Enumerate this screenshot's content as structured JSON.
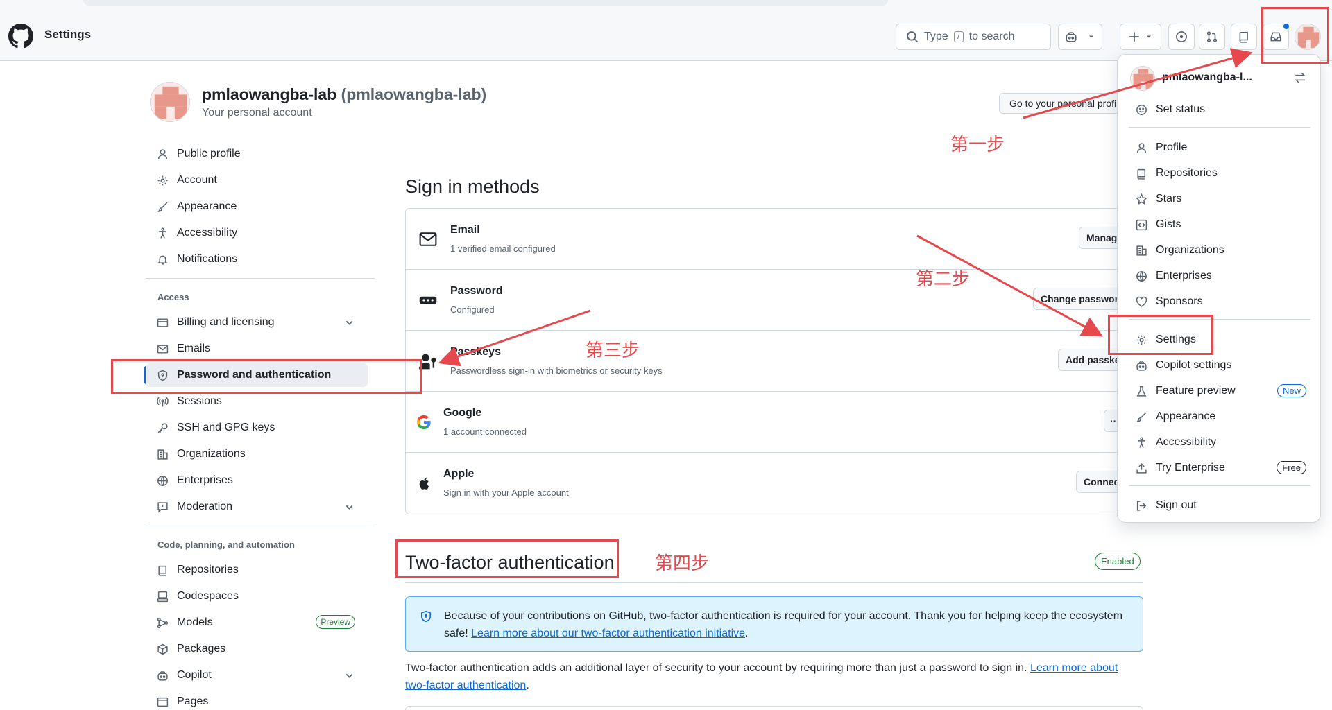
{
  "header": {
    "title": "Settings",
    "search_prefix": "Type",
    "search_key": "/",
    "search_suffix": "to search"
  },
  "profile": {
    "name": "pmlaowangba-lab",
    "alias": "(pmlaowangba-lab)",
    "subtitle": "Your personal account",
    "go_button": "Go to your personal profile"
  },
  "sidebar": {
    "items_top": [
      {
        "label": "Public profile"
      },
      {
        "label": "Account"
      },
      {
        "label": "Appearance"
      },
      {
        "label": "Accessibility"
      },
      {
        "label": "Notifications"
      }
    ],
    "access_heading": "Access",
    "access_items": [
      {
        "label": "Billing and licensing"
      },
      {
        "label": "Emails"
      },
      {
        "label": "Password and authentication"
      },
      {
        "label": "Sessions"
      },
      {
        "label": "SSH and GPG keys"
      },
      {
        "label": "Organizations"
      },
      {
        "label": "Enterprises"
      },
      {
        "label": "Moderation"
      }
    ],
    "code_heading": "Code, planning, and automation",
    "code_items": [
      {
        "label": "Repositories"
      },
      {
        "label": "Codespaces"
      },
      {
        "label": "Models",
        "badge": "Preview"
      },
      {
        "label": "Packages"
      },
      {
        "label": "Copilot"
      },
      {
        "label": "Pages"
      }
    ]
  },
  "main": {
    "sign_in_title": "Sign in methods",
    "methods": [
      {
        "title": "Email",
        "desc": "1 verified email configured",
        "button": "Manage"
      },
      {
        "title": "Password",
        "desc": "Configured",
        "button": "Change password"
      },
      {
        "title": "Passkeys",
        "desc": "Passwordless sign-in with biometrics or security keys",
        "button": "Add passkey"
      },
      {
        "title": "Google",
        "desc": "1 account connected",
        "button": "···"
      },
      {
        "title": "Apple",
        "desc": "Sign in with your Apple account",
        "button": "Connect"
      }
    ],
    "tfa_title": "Two-factor authentication",
    "tfa_badge": "Enabled",
    "flash_text": "Because of your contributions on GitHub, two-factor authentication is required for your account. Thank you for helping keep the ecosystem safe!",
    "flash_link": "Learn more about our two-factor authentication initiative",
    "para_text": "Two-factor authentication adds an additional layer of security to your account by requiring more than just a password to sign in.",
    "para_link": "Learn more about two-factor authentication"
  },
  "dropdown": {
    "username": "pmlaowangba-l...",
    "items": [
      {
        "label": "Set status"
      },
      {
        "label": "Profile"
      },
      {
        "label": "Repositories"
      },
      {
        "label": "Stars"
      },
      {
        "label": "Gists"
      },
      {
        "label": "Organizations"
      },
      {
        "label": "Enterprises"
      },
      {
        "label": "Sponsors"
      },
      {
        "label": "Settings"
      },
      {
        "label": "Copilot settings"
      },
      {
        "label": "Feature preview",
        "badge": "New"
      },
      {
        "label": "Appearance"
      },
      {
        "label": "Accessibility"
      },
      {
        "label": "Try Enterprise",
        "badge": "Free"
      },
      {
        "label": "Sign out"
      }
    ]
  },
  "annotations": {
    "step1": "第一步",
    "step2": "第二步",
    "step3": "第三步",
    "step4": "第四步"
  },
  "colors": {
    "accent": "#0969da",
    "annotation": "#e5484d",
    "success": "#1a7f37"
  }
}
